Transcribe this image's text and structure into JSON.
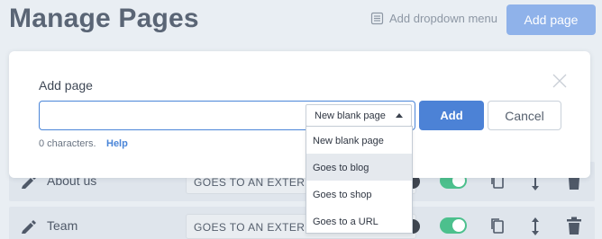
{
  "header": {
    "title": "Manage Pages",
    "add_dropdown_label": "Add dropdown menu",
    "add_page_label": "Add page"
  },
  "rows": [
    {
      "label": "About us",
      "target": "GOES TO AN EXTERNAL URL"
    },
    {
      "label": "Team",
      "target": "GOES TO AN EXTERNAL URL"
    }
  ],
  "modal": {
    "title": "Add page",
    "input_value": "",
    "select_value": "New blank page",
    "add_label": "Add",
    "cancel_label": "Cancel",
    "char_count": "0 characters.",
    "help_label": "Help"
  },
  "dropdown": {
    "options": [
      "New blank page",
      "Goes to blog",
      "Goes to shop",
      "Goes to a URL"
    ],
    "hovered_option": "Goes to blog"
  },
  "colors": {
    "accent": "#4c82d6",
    "accent_disabled": "#8fb2ea",
    "toggle_on": "#4cc08d",
    "background": "#e9eef3"
  }
}
